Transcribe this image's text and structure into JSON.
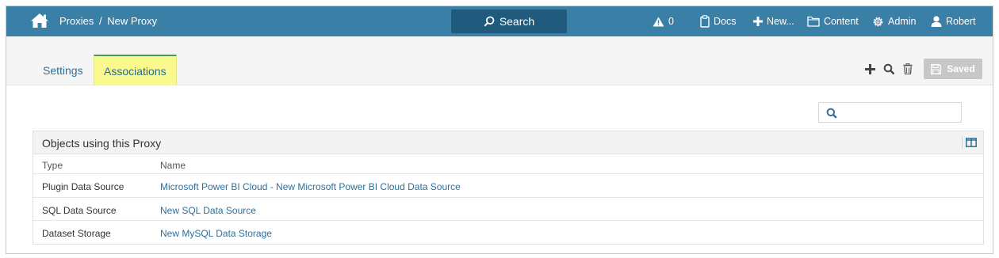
{
  "header": {
    "breadcrumb": {
      "parent": "Proxies",
      "separator": "/",
      "current": "New Proxy"
    },
    "search_label": "Search",
    "alerts_count": "0",
    "docs_label": "Docs",
    "new_label": "New...",
    "content_label": "Content",
    "admin_label": "Admin",
    "user_label": "Robert"
  },
  "tabs": [
    {
      "label": "Settings",
      "active": false
    },
    {
      "label": "Associations",
      "active": true
    }
  ],
  "toolbar": {
    "saved_label": "Saved"
  },
  "filter": {
    "placeholder": "",
    "value": ""
  },
  "table": {
    "title": "Objects using this Proxy",
    "columns": [
      "Type",
      "Name"
    ],
    "rows": [
      {
        "type": "Plugin Data Source",
        "name": "Microsoft Power BI Cloud - New Microsoft Power BI Cloud Data Source"
      },
      {
        "type": "SQL Data Source",
        "name": "New SQL Data Source"
      },
      {
        "type": "Dataset Storage",
        "name": "New MySQL Data Storage"
      }
    ]
  },
  "colors": {
    "topbar": "#3a7fa6",
    "search_button": "#205b7d",
    "link": "#2e6f99",
    "active_tab_bg": "#f9f98d",
    "active_tab_border": "#4c9a52",
    "saved_button": "#c7c7c7"
  },
  "icons": {
    "home": "home-icon",
    "search": "search-icon",
    "alert": "warning-icon",
    "docs": "clipboard-icon",
    "new": "plus-icon",
    "content": "folder-icon",
    "admin": "gear-icon",
    "user": "user-icon",
    "add": "plus-icon",
    "find": "magnifier-icon",
    "delete": "trash-icon",
    "save": "floppy-icon",
    "columns": "columns-icon"
  }
}
